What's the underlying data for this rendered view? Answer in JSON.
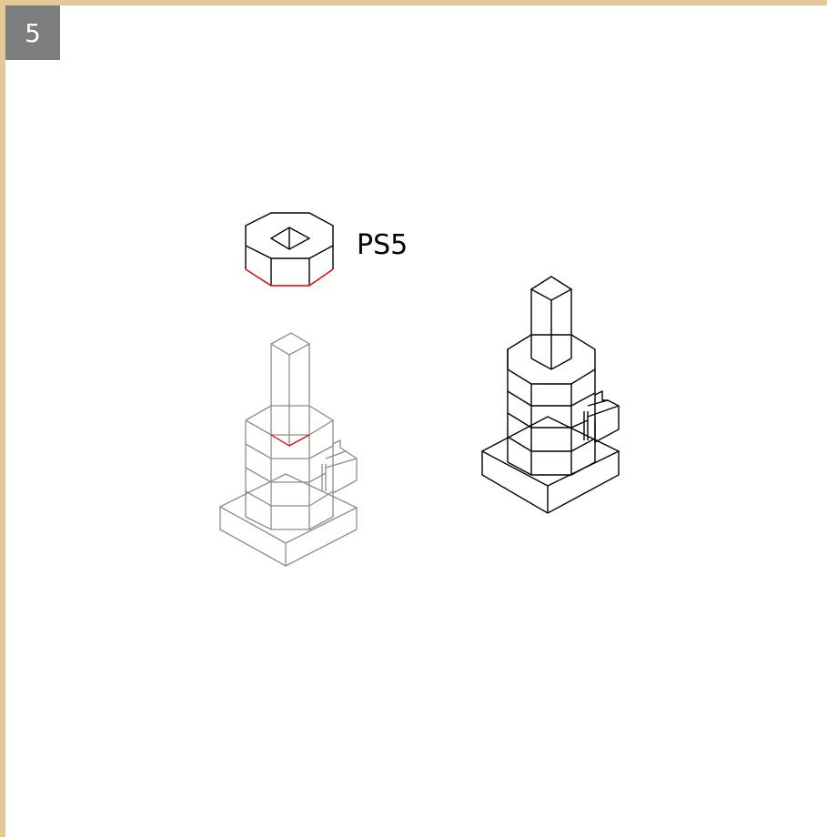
{
  "step": {
    "number": "5"
  },
  "part": {
    "label": "PS5"
  },
  "colors": {
    "frame": "#e3c99a",
    "badge_bg": "#7d7d7d",
    "badge_text": "#ffffff",
    "highlight_edge": "#e00000",
    "ghost_line": "#8c8c8c",
    "ink_line": "#000000"
  }
}
